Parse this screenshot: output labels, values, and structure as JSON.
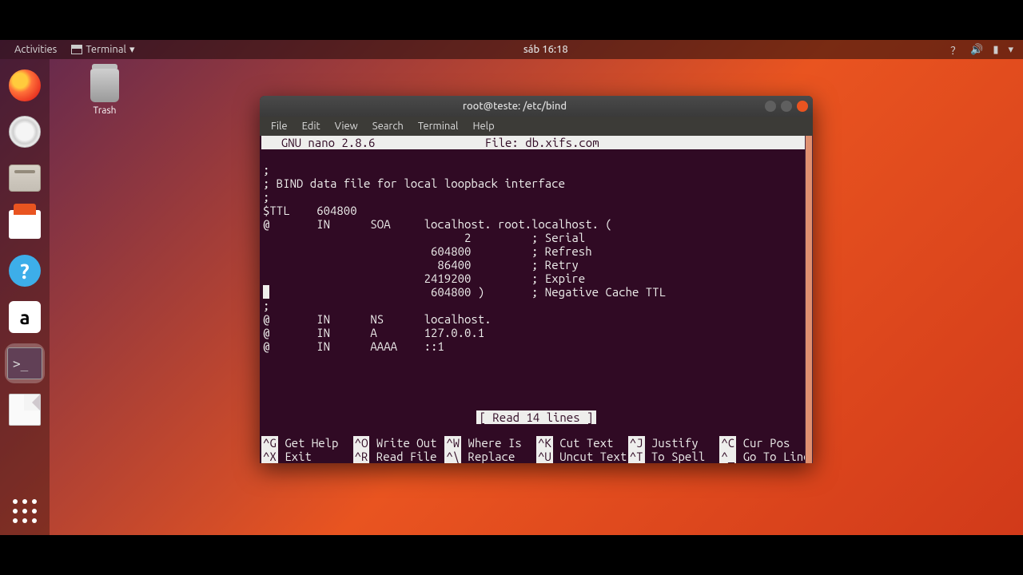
{
  "topbar": {
    "activities": "Activities",
    "app_label": "Terminal",
    "clock": "sáb 16:18"
  },
  "desktop": {
    "trash_label": "Trash"
  },
  "window": {
    "title": "root@teste: /etc/bind",
    "menus": [
      "File",
      "Edit",
      "View",
      "Search",
      "Terminal",
      "Help"
    ]
  },
  "nano": {
    "app": "  GNU nano 2.8.6",
    "file_label": "File: db.xifs.com",
    "status": "[ Read 14 lines ]",
    "lines": [
      ";",
      "; BIND data file for local loopback interface",
      ";",
      "$TTL    604800",
      "@       IN      SOA     localhost. root.localhost. (",
      "                              2         ; Serial",
      "                         604800         ; Refresh",
      "                          86400         ; Retry",
      "                        2419200         ; Expire",
      "                         604800 )       ; Negative Cache TTL",
      ";",
      "@       IN      NS      localhost.",
      "@       IN      A       127.0.0.1",
      "@       IN      AAAA    ::1"
    ],
    "cursor_line_index": 9,
    "help_row1": [
      {
        "k": "^G",
        "t": " Get Help"
      },
      {
        "k": "^O",
        "t": " Write Out"
      },
      {
        "k": "^W",
        "t": " Where Is"
      },
      {
        "k": "^K",
        "t": " Cut Text"
      },
      {
        "k": "^J",
        "t": " Justify"
      },
      {
        "k": "^C",
        "t": " Cur Pos"
      }
    ],
    "help_row2": [
      {
        "k": "^X",
        "t": " Exit"
      },
      {
        "k": "^R",
        "t": " Read File"
      },
      {
        "k": "^\\",
        "t": " Replace"
      },
      {
        "k": "^U",
        "t": " Uncut Text"
      },
      {
        "k": "^T",
        "t": " To Spell"
      },
      {
        "k": "^_",
        "t": " Go To Line"
      }
    ]
  }
}
